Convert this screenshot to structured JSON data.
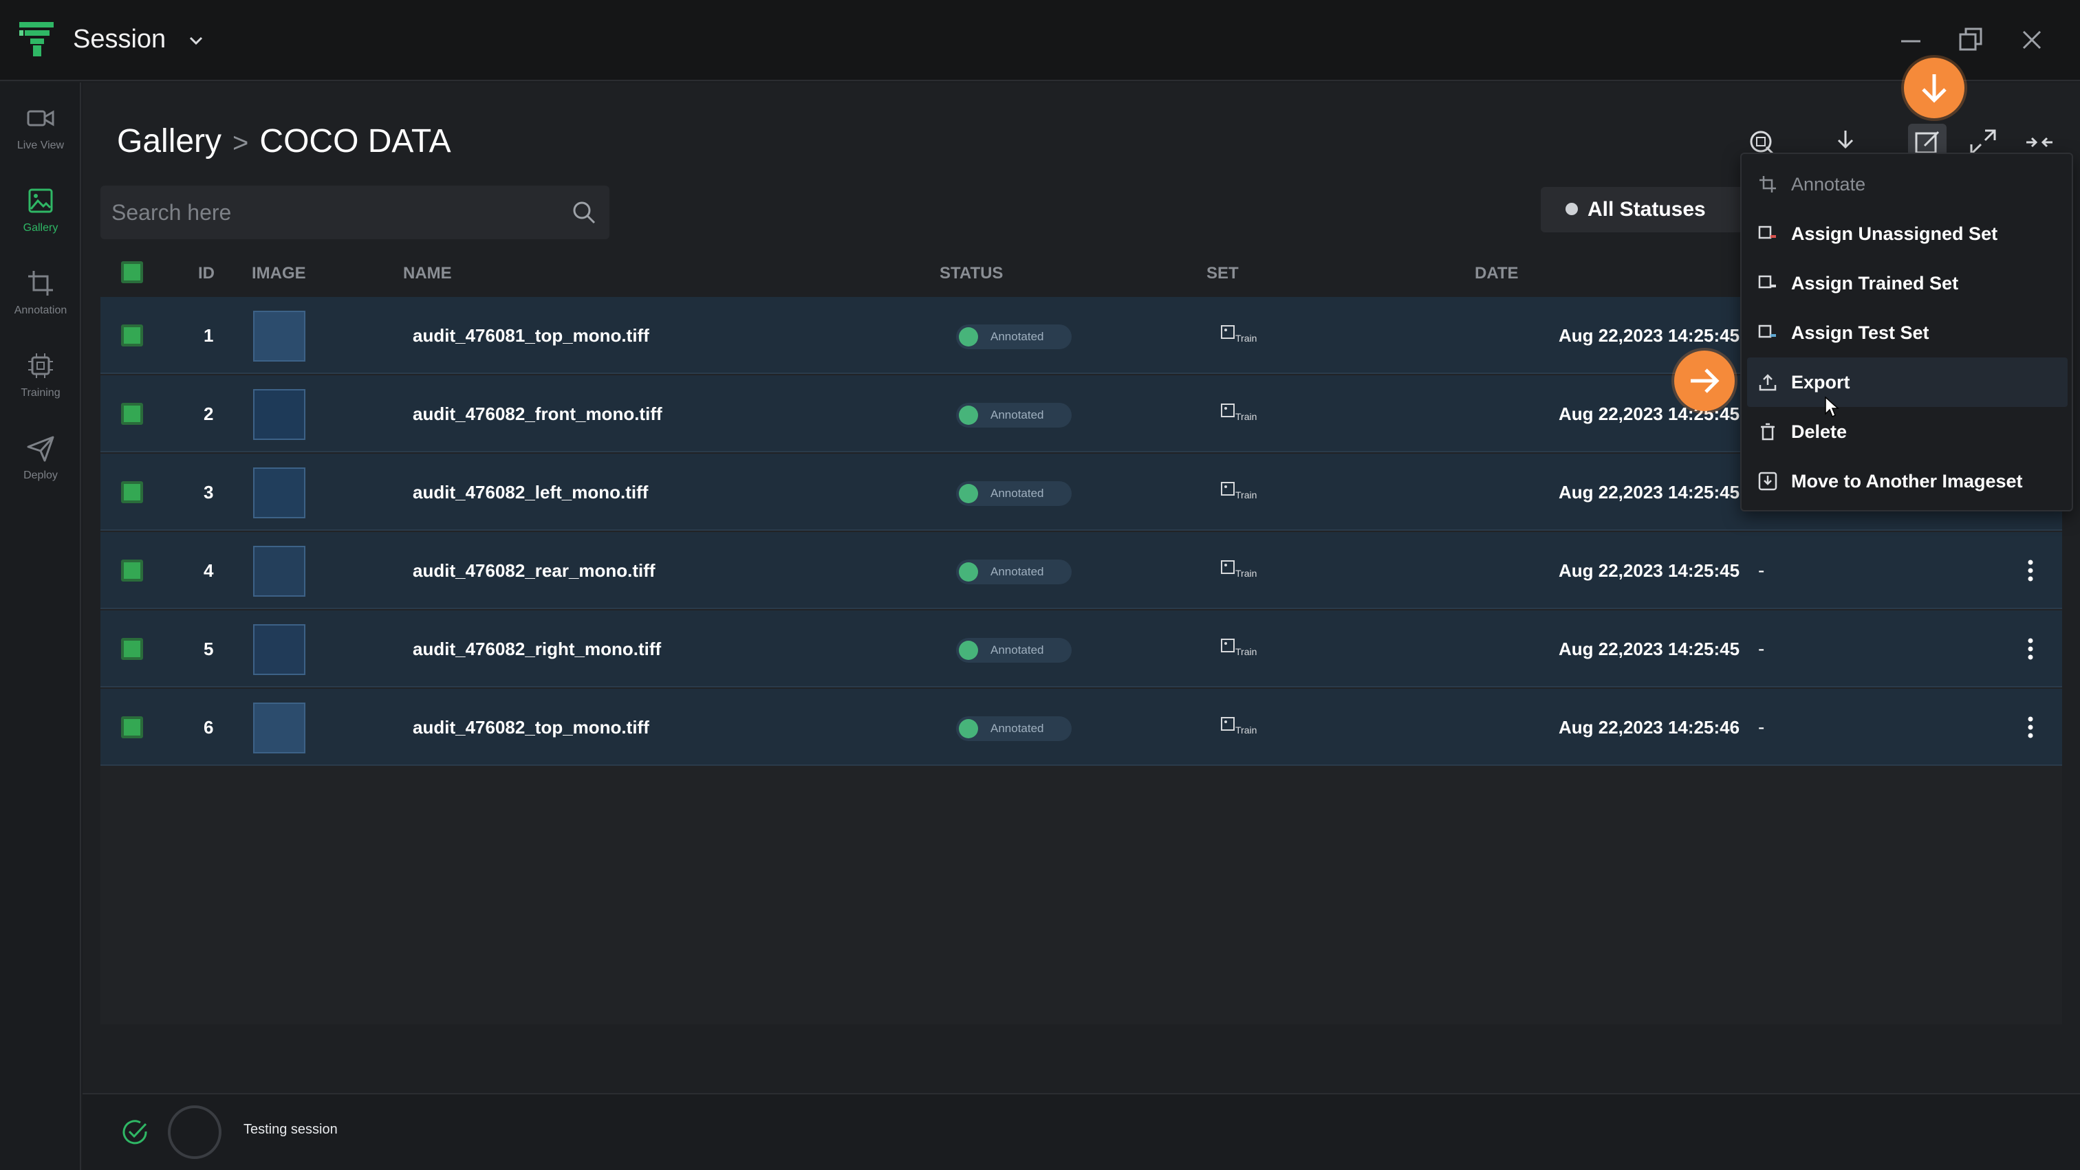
{
  "window": {
    "title": "Session"
  },
  "sidebar": {
    "items": [
      {
        "label": "Live View",
        "icon": "video-camera-icon"
      },
      {
        "label": "Gallery",
        "icon": "image-icon",
        "active": true
      },
      {
        "label": "Annotation",
        "icon": "crop-icon"
      },
      {
        "label": "Training",
        "icon": "chip-icon"
      },
      {
        "label": "Deploy",
        "icon": "send-icon"
      }
    ]
  },
  "header": {
    "breadcrumb_root": "Gallery",
    "breadcrumb_sep": ">",
    "breadcrumb_current": "COCO DATA"
  },
  "search": {
    "placeholder": "Search here"
  },
  "filter": {
    "status_label": "All Statuses"
  },
  "table": {
    "columns": {
      "id": "ID",
      "image": "IMAGE",
      "name": "NAME",
      "status": "STATUS",
      "set": "SET",
      "date": "DATE"
    },
    "rows": [
      {
        "id": "1",
        "name": "audit_476081_top_mono.tiff",
        "status": "Annotated",
        "set": "Train",
        "date": "Aug 22,2023 14:25:45",
        "extra": ""
      },
      {
        "id": "2",
        "name": "audit_476082_front_mono.tiff",
        "status": "Annotated",
        "set": "Train",
        "date": "Aug 22,2023 14:25:45",
        "extra": ""
      },
      {
        "id": "3",
        "name": "audit_476082_left_mono.tiff",
        "status": "Annotated",
        "set": "Train",
        "date": "Aug 22,2023 14:25:45",
        "extra": ""
      },
      {
        "id": "4",
        "name": "audit_476082_rear_mono.tiff",
        "status": "Annotated",
        "set": "Train",
        "date": "Aug 22,2023 14:25:45",
        "extra": "-"
      },
      {
        "id": "5",
        "name": "audit_476082_right_mono.tiff",
        "status": "Annotated",
        "set": "Train",
        "date": "Aug 22,2023 14:25:45",
        "extra": "-"
      },
      {
        "id": "6",
        "name": "audit_476082_top_mono.tiff",
        "status": "Annotated",
        "set": "Train",
        "date": "Aug 22,2023 14:25:46",
        "extra": "-"
      }
    ]
  },
  "menu": {
    "items": [
      {
        "label": "Annotate",
        "icon": "crop-icon",
        "disabled": true
      },
      {
        "label": "Assign Unassigned Set",
        "icon": "unassigned-set-icon"
      },
      {
        "label": "Assign Trained Set",
        "icon": "train-set-icon"
      },
      {
        "label": "Assign Test Set",
        "icon": "test-set-icon"
      },
      {
        "label": "Export",
        "icon": "upload-icon",
        "hover": true
      },
      {
        "label": "Delete",
        "icon": "trash-icon"
      },
      {
        "label": "Move to Another Imageset",
        "icon": "move-icon"
      }
    ]
  },
  "footer": {
    "status_text": "Testing session"
  },
  "colors": {
    "accent_green": "#2fb765",
    "callout_orange": "#f58a3a",
    "row_bg": "#1f2e3c"
  }
}
